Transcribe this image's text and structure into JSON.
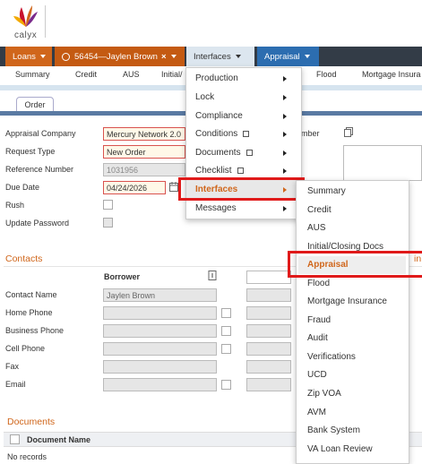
{
  "app": {
    "brand": "calyx"
  },
  "top_tabs": {
    "loans": "Loans",
    "loan": "56454—Jaylen Brown",
    "interfaces": "Interfaces",
    "appraisal": "Appraisal"
  },
  "sub_nav": [
    "Summary",
    "Credit",
    "AUS",
    "Initial/",
    "Flood",
    "Mortgage Insura"
  ],
  "order_tab": "Order",
  "form": {
    "appraisal_company_label": "Appraisal Company",
    "appraisal_company_value": "Mercury Network 2.0",
    "request_type_label": "Request Type",
    "request_type_value": "New Order",
    "reference_number_label": "Reference Number",
    "reference_number_value": "1031956",
    "due_date_label": "Due Date",
    "due_date_value": "04/24/2026",
    "rush_label": "Rush",
    "update_password_label": "Update Password",
    "number_label_fragment": "mber"
  },
  "contacts": {
    "title": "Contacts",
    "borrower_header": "Borrower",
    "right_fragment": "in",
    "rows": [
      {
        "label": "Contact Name",
        "value": "Jaylen Brown"
      },
      {
        "label": "Home Phone",
        "value": ""
      },
      {
        "label": "Business Phone",
        "value": ""
      },
      {
        "label": "Cell Phone",
        "value": ""
      },
      {
        "label": "Fax",
        "value": ""
      },
      {
        "label": "Email",
        "value": ""
      }
    ]
  },
  "documents": {
    "title": "Documents",
    "column": "Document Name",
    "empty": "No records"
  },
  "interfaces_menu": {
    "items": [
      "Production",
      "Lock",
      "Compliance",
      "Conditions",
      "Documents",
      "Checklist",
      "Interfaces",
      "Messages"
    ],
    "selected": "Interfaces"
  },
  "interfaces_submenu": {
    "items": [
      "Summary",
      "Credit",
      "AUS",
      "Initial/Closing Docs",
      "Appraisal",
      "Flood",
      "Mortgage Insurance",
      "Fraud",
      "Audit",
      "Verifications",
      "UCD",
      "Zip VOA",
      "AVM",
      "Bank System",
      "VA Loan Review"
    ],
    "selected": "Appraisal"
  },
  "colors": {
    "accent_orange": "#d0661b",
    "nav_dark": "#333c47",
    "appraisal_blue": "#2c6db0",
    "highlight_red": "#e01a1a"
  }
}
